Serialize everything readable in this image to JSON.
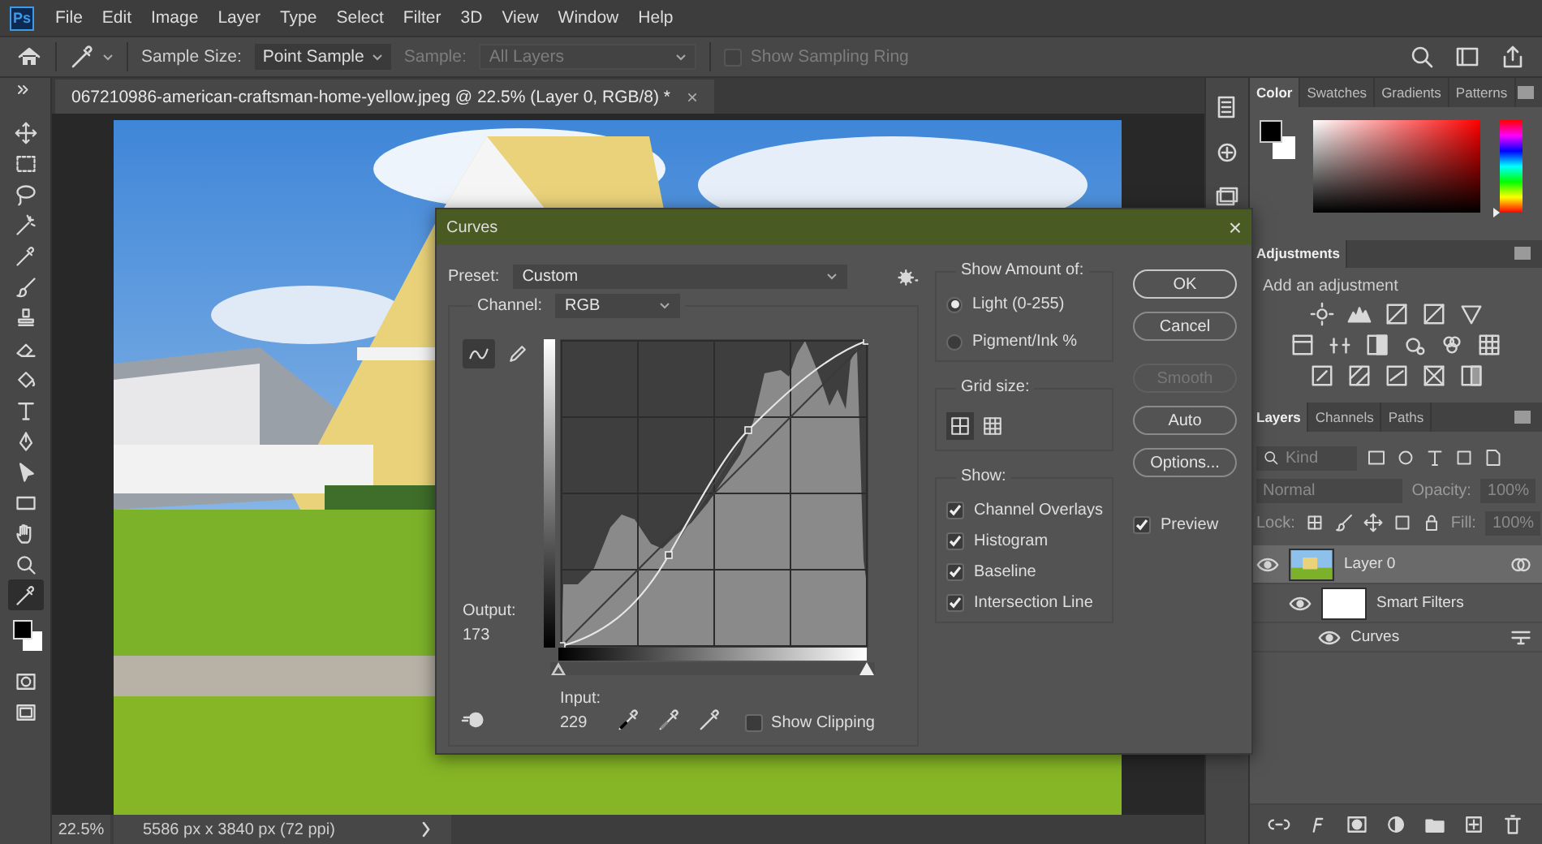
{
  "app_logo": "Ps",
  "menu": [
    "File",
    "Edit",
    "Image",
    "Layer",
    "Type",
    "Select",
    "Filter",
    "3D",
    "View",
    "Window",
    "Help"
  ],
  "options_bar": {
    "sample_size_label": "Sample Size:",
    "sample_size": "Point Sample",
    "sample_label": "Sample:",
    "sample": "All Layers",
    "sample_disabled": true,
    "sampling_ring": {
      "label": "Show Sampling Ring",
      "checked": false,
      "disabled": true
    }
  },
  "document_tab": {
    "title": "067210986-american-craftsman-home-yellow.jpeg @ 22.5% (Layer 0, RGB/8) *",
    "close": "×"
  },
  "tools": [
    {
      "kind": "move",
      "selected": false
    },
    {
      "kind": "marquee",
      "selected": false
    },
    {
      "kind": "lasso",
      "selected": false
    },
    {
      "kind": "wand",
      "selected": false
    },
    {
      "kind": "eyedropper",
      "selected": false
    },
    {
      "kind": "brush",
      "selected": false
    },
    {
      "kind": "stamp",
      "selected": false
    },
    {
      "kind": "eraser",
      "selected": false
    },
    {
      "kind": "bucket",
      "selected": false
    },
    {
      "kind": "type",
      "selected": false
    },
    {
      "kind": "pen",
      "selected": false
    },
    {
      "kind": "pointer",
      "selected": false
    },
    {
      "kind": "rectangle",
      "selected": false
    },
    {
      "kind": "hand",
      "selected": false
    },
    {
      "kind": "zoom",
      "selected": false
    },
    {
      "kind": "eyedropper",
      "selected": true
    }
  ],
  "status_bar": {
    "zoom": "22.5%",
    "info": "5586 px x 3840 px (72 ppi)"
  },
  "color_panel": {
    "hue_slider": {
      "level": 0
    },
    "tabs": [
      {
        "label": "Color",
        "selected": true
      },
      {
        "label": "Swatches",
        "selected": false
      },
      {
        "label": "Gradients",
        "selected": false
      },
      {
        "label": "Patterns",
        "selected": false
      }
    ]
  },
  "adjustments_panel": {
    "tabs": [
      {
        "label": "Adjustments",
        "selected": true
      }
    ],
    "hint": "Add an adjustment"
  },
  "layers_panel": {
    "tabs": [
      {
        "label": "Layers",
        "selected": true
      },
      {
        "label": "Channels",
        "selected": false
      },
      {
        "label": "Paths",
        "selected": false
      }
    ],
    "filter_placeholder": "Kind",
    "blend_mode": "Normal",
    "opacity_label": "Opacity:",
    "opacity": "100%",
    "lock_label": "Lock:",
    "fill_label": "Fill:",
    "fill": "100%",
    "layers": [
      {
        "kind": "layer",
        "name": "Layer 0",
        "visible": true,
        "selected": true,
        "children": [
          {
            "kind": "smart_filters",
            "name": "Smart Filters",
            "visible": true,
            "selected": false,
            "children": [
              {
                "kind": "filter",
                "name": "Curves",
                "visible": true,
                "selected": false
              }
            ]
          }
        ]
      }
    ]
  },
  "curves_dialog": {
    "title": "Curves",
    "close": "×",
    "preset_label": "Preset:",
    "preset": "Custom",
    "channel_label": "Channel:",
    "channel": "RGB",
    "edit_modes": [
      {
        "kind": "curve",
        "selected": true
      },
      {
        "kind": "pencil",
        "selected": false
      }
    ],
    "input_black_point": {
      "level": 0
    },
    "input_white_point": {
      "level": 1
    },
    "output_label": "Output:",
    "output": "173",
    "input_label": "Input:",
    "input": "229",
    "show_clipping": {
      "label": "Show Clipping",
      "checked": false
    },
    "show_amount": {
      "title": "Show Amount of:",
      "options": [
        {
          "label": "Light (0-255)",
          "selected": true
        },
        {
          "label": "Pigment/Ink %",
          "selected": false
        }
      ]
    },
    "grid_size": {
      "title": "Grid size:",
      "options": [
        {
          "kind": "coarse",
          "selected": true
        },
        {
          "kind": "fine",
          "selected": false
        }
      ]
    },
    "show": {
      "title": "Show:",
      "options": [
        {
          "label": "Channel Overlays",
          "checked": true
        },
        {
          "label": "Histogram",
          "checked": true
        },
        {
          "label": "Baseline",
          "checked": true
        },
        {
          "label": "Intersection Line",
          "checked": true
        }
      ]
    },
    "buttons": [
      {
        "label": "OK",
        "kind": "default",
        "disabled": false
      },
      {
        "label": "Cancel",
        "kind": "normal",
        "disabled": false
      },
      {
        "label": "Smooth",
        "kind": "normal",
        "disabled": true
      },
      {
        "label": "Auto",
        "kind": "normal",
        "disabled": false
      },
      {
        "label": "Options...",
        "kind": "normal",
        "disabled": false
      }
    ],
    "preview": {
      "label": "Preview",
      "checked": true
    }
  }
}
